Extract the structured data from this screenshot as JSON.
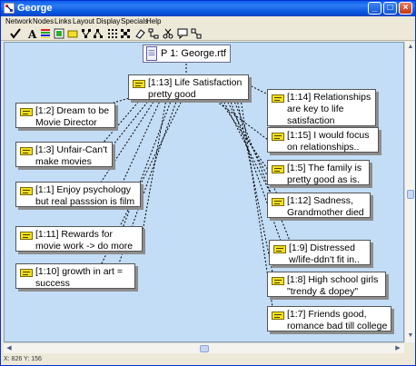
{
  "window": {
    "title": "George",
    "statusbar": "X: 826 Y: 156"
  },
  "menu": [
    "Network",
    "Nodes",
    "Links",
    "Layout",
    "Display",
    "Specials",
    "Help"
  ],
  "toolbar_icons": [
    "check-icon",
    "font-icon",
    "color-lines-icon",
    "layout-icon",
    "node-icon",
    "tree-icon",
    "tree-alt-icon",
    "grid-icon",
    "grid-alt-icon",
    "eraser-icon",
    "connect-icon",
    "cut-icon",
    "comment-icon",
    "link-icon"
  ],
  "document": {
    "label": "P 1: George.rtf"
  },
  "nodes": [
    {
      "id": "1:13",
      "text": "[1:13] Life Satisfaction\npretty good"
    },
    {
      "id": "1:2",
      "text": "[1:2] Dream to be\nMovie Director"
    },
    {
      "id": "1:3",
      "text": "[1:3] Unfair-Can't\nmake movies"
    },
    {
      "id": "1:1",
      "text": "[1:1] Enjoy psychology\nbut real passsion is film"
    },
    {
      "id": "1:11",
      "text": "[1:11] Rewards for\nmovie work -> do more"
    },
    {
      "id": "1:10",
      "text": "[1:10] growth in art =\nsuccess"
    },
    {
      "id": "1:14",
      "text": "[1:14] Relationships\nare key to life\nsatisfaction"
    },
    {
      "id": "1:15",
      "text": "[1:15] I would focus\non relationships.."
    },
    {
      "id": "1:5",
      "text": "[1:5] The family is\npretty good as is."
    },
    {
      "id": "1:12",
      "text": "[1:12] Sadness,\nGrandmother died"
    },
    {
      "id": "1:9",
      "text": "[1:9] Distressed\nw/life-ddn't fit in.."
    },
    {
      "id": "1:8",
      "text": "[1:8] High school girls\n\"trendy & dopey\""
    },
    {
      "id": "1:7",
      "text": "[1:7] Friends good,\nromance bad till college"
    }
  ]
}
